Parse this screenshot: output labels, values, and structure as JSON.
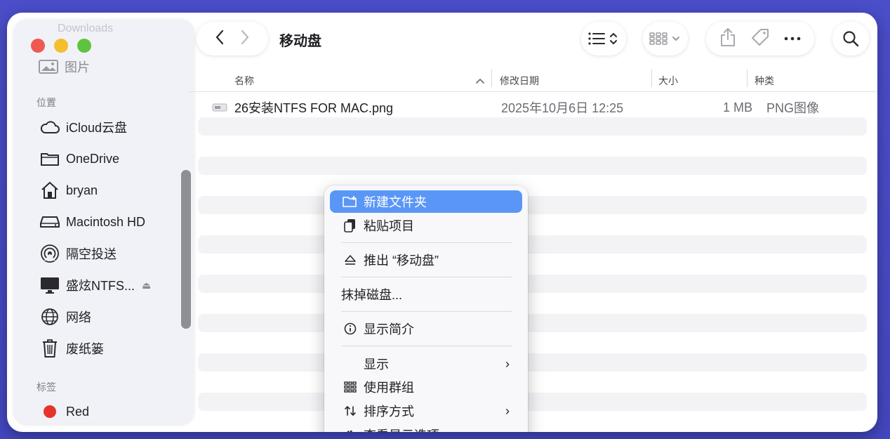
{
  "window": {
    "title": "移动盘"
  },
  "sidebar": {
    "faded_top": "Downloads",
    "faded_item": "图片",
    "section_locations": "位置",
    "locations": [
      {
        "label": "iCloud云盘",
        "icon": "cloud-icon"
      },
      {
        "label": "OneDrive",
        "icon": "folder-icon"
      },
      {
        "label": "bryan",
        "icon": "home-icon"
      },
      {
        "label": "Macintosh HD",
        "icon": "disk-icon"
      },
      {
        "label": "隔空投送",
        "icon": "airdrop-icon"
      },
      {
        "label": "盛炫NTFS...",
        "icon": "display-icon"
      },
      {
        "label": "网络",
        "icon": "globe-icon"
      },
      {
        "label": "废纸篓",
        "icon": "trash-icon"
      }
    ],
    "section_tags": "标签",
    "tags": [
      {
        "label": "Red",
        "color": "#e7332b"
      }
    ]
  },
  "columns": {
    "name": "名称",
    "modified": "修改日期",
    "size": "大小",
    "kind": "种类"
  },
  "files": [
    {
      "name": "26安装NTFS FOR MAC.png",
      "modified": "2025年10月6日 12:25",
      "size": "1 MB",
      "kind": "PNG图像"
    }
  ],
  "context_menu": {
    "new_folder": "新建文件夹",
    "paste": "粘贴项目",
    "eject": "推出 “移动盘”",
    "erase": "抹掉磁盘...",
    "get_info": "显示简介",
    "show": "显示",
    "use_groups": "使用群组",
    "sort_by": "排序方式",
    "view_options": "查看显示选项"
  },
  "colors": {
    "highlight": "#5a96f6",
    "background": "#4a4ec9"
  }
}
